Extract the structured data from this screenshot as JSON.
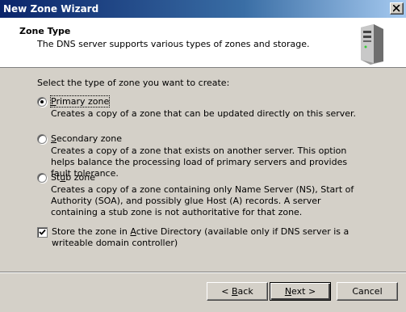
{
  "window": {
    "title": "New Zone Wizard"
  },
  "header": {
    "title": "Zone Type",
    "subtitle": "The DNS server supports various types of zones and storage."
  },
  "prompt": "Select the type of zone you want to create:",
  "options": [
    {
      "label_pre": "",
      "mnemonic": "P",
      "label_post": "rimary zone",
      "selected": true,
      "description": "Creates a copy of a zone that can be updated directly on this server."
    },
    {
      "label_pre": "",
      "mnemonic": "S",
      "label_post": "econdary zone",
      "selected": false,
      "description": "Creates a copy of a zone that exists on another server. This option helps balance the processing load of primary servers and provides fault tolerance."
    },
    {
      "label_pre": "St",
      "mnemonic": "u",
      "label_post": "b zone",
      "selected": false,
      "description": "Creates a copy of a zone containing only Name Server (NS), Start of Authority (SOA), and possibly glue Host (A) records. A server containing a stub zone is not authoritative for that zone."
    }
  ],
  "ad_checkbox": {
    "checked": true,
    "label_pre": "Store the zone in ",
    "mnemonic": "A",
    "label_post": "ctive Directory (available only if DNS server is a writeable domain controller)"
  },
  "buttons": {
    "back": {
      "pre": "< ",
      "mnemonic": "B",
      "post": "ack"
    },
    "next": {
      "pre": "",
      "mnemonic": "N",
      "post": "ext >"
    },
    "cancel": {
      "label": "Cancel"
    }
  }
}
